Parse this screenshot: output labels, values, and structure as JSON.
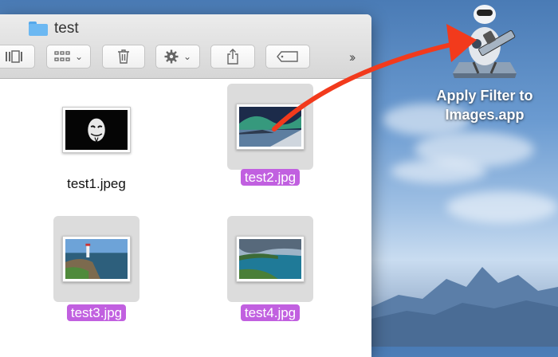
{
  "window": {
    "title": "test",
    "toolbar": [
      "view-columns-icon",
      "group-icon",
      "trash-icon",
      "gear-icon",
      "share-icon",
      "tag-icon",
      "overflow-icon"
    ]
  },
  "files": [
    {
      "name": "test1.jpeg",
      "selected": false
    },
    {
      "name": "test2.jpg",
      "selected": true
    },
    {
      "name": "test3.jpg",
      "selected": true
    },
    {
      "name": "test4.jpg",
      "selected": true
    }
  ],
  "desktop": {
    "app_name_line1": "Apply Filter to",
    "app_name_line2": "Images.app"
  },
  "colors": {
    "selection": "#c160e0",
    "arrow": "#f23a1c",
    "folder": "#6cb8f2"
  }
}
